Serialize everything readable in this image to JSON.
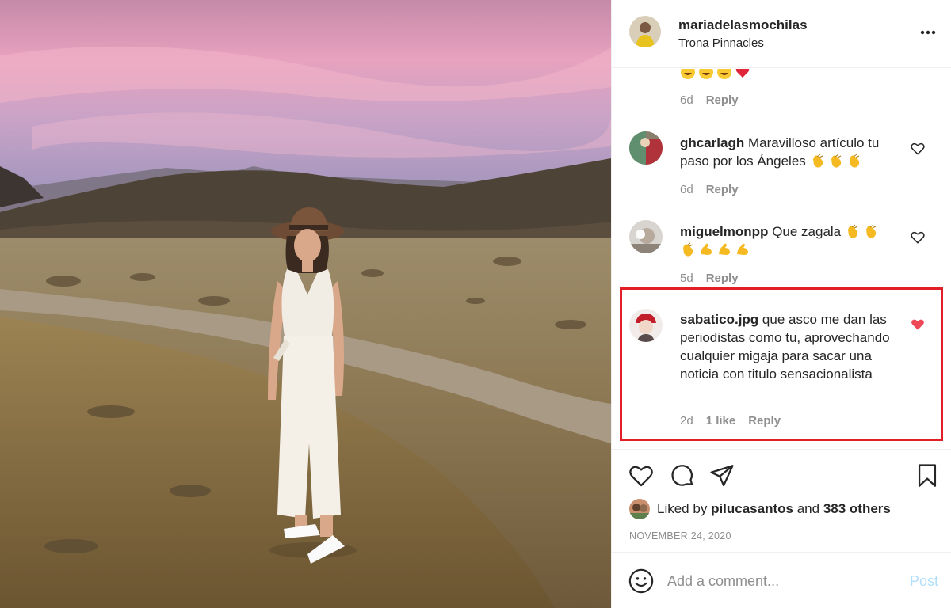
{
  "post": {
    "username": "mariadelasmochilas",
    "location": "Trona Pinnacles"
  },
  "comments": [
    {
      "age": "6d",
      "reply_label": "Reply"
    },
    {
      "username": "ghcarlagh",
      "text": "Maravilloso artículo tu paso por los Ángeles",
      "age": "6d",
      "reply_label": "Reply"
    },
    {
      "username": "miguelmonpp",
      "text": "Que zagala",
      "age": "5d",
      "reply_label": "Reply"
    },
    {
      "username": "sabatico.jpg",
      "text": "que asco me dan las periodistas como tu, aprovechando cualquier migaja para sacar una noticia con titulo sensacionalista",
      "age": "2d",
      "likes": "1 like",
      "reply_label": "Reply",
      "liked": true
    }
  ],
  "likes": {
    "prefix": "Liked by",
    "user": "pilucasantos",
    "connector": "and",
    "others": "383 others"
  },
  "date": "NOVEMBER 24, 2020",
  "composer": {
    "placeholder": "Add a comment...",
    "post_label": "Post"
  },
  "colors": {
    "highlight_border": "#e21f26",
    "like_red": "#ed4956",
    "post_disabled": "#b2dffc",
    "muted_text": "#8e8e8e"
  },
  "icons": [
    "more-options-icon",
    "heart-icon",
    "comment-icon",
    "share-icon",
    "bookmark-icon",
    "smile-icon",
    "clapping-hands-emoji",
    "laughing-emoji",
    "red-heart-emoji",
    "flexed-biceps-emoji"
  ]
}
